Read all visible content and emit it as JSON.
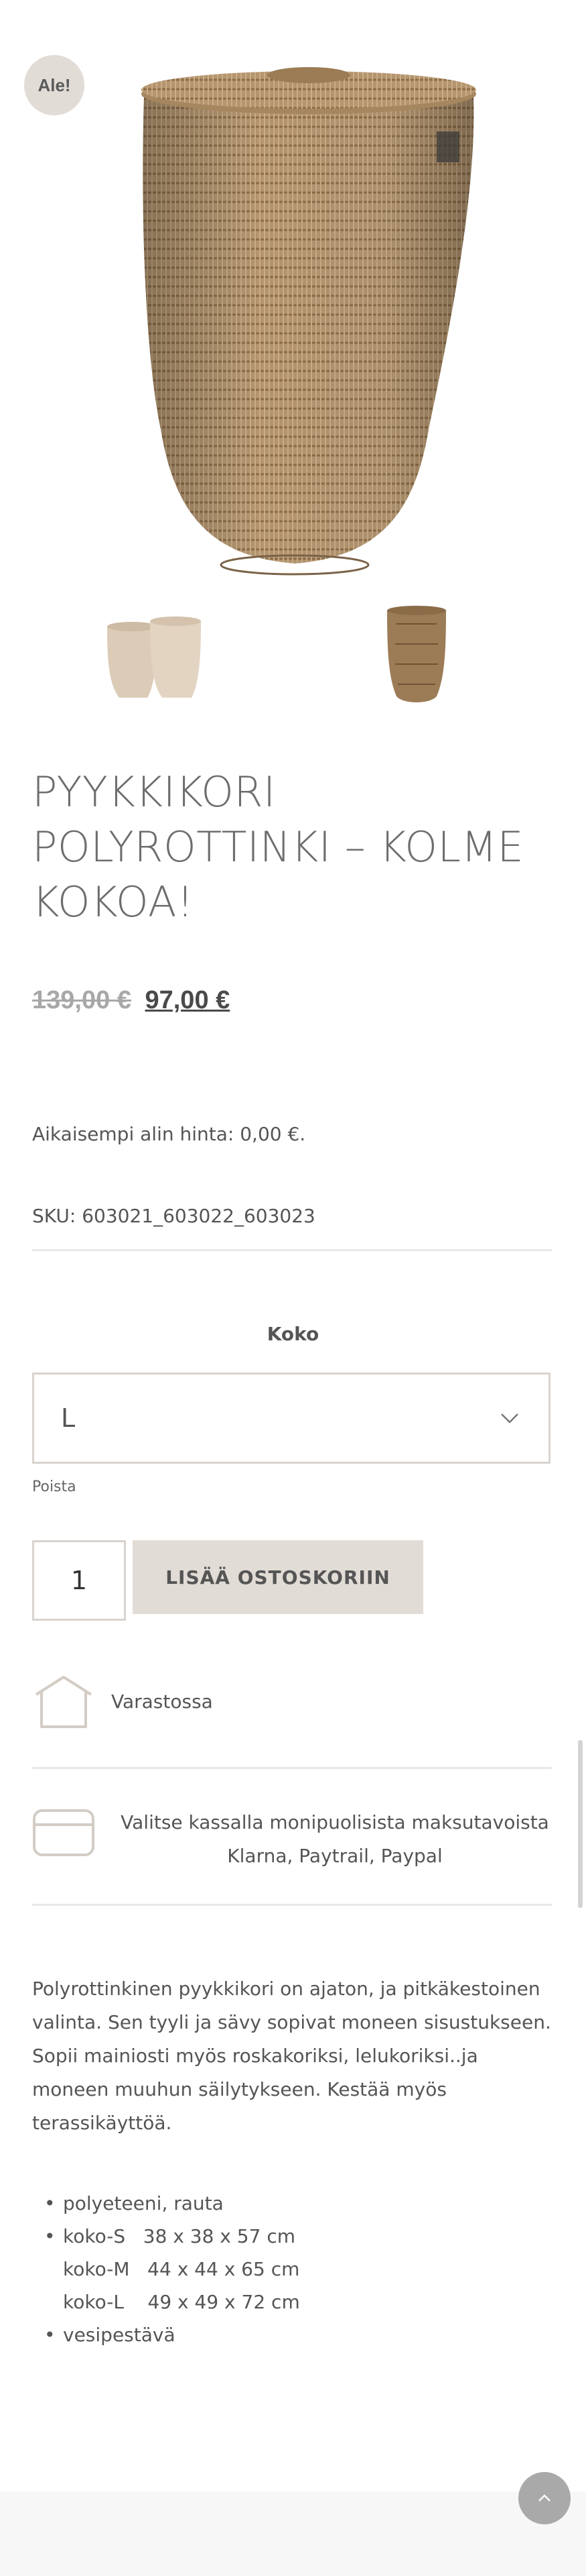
{
  "badge": {
    "label": "Ale!"
  },
  "product": {
    "title": "PYYKKIKORI POLYROTTINKI – KOLME KOKOA!",
    "price_old": "139,00 €",
    "price_new": "97,00 €",
    "previous_low": "Aikaisempi alin hinta: 0,00 €.",
    "sku": "SKU: 603021_603022_603023"
  },
  "variation": {
    "label": "Koko",
    "selected": "L",
    "reset_label": "Poista"
  },
  "cart": {
    "quantity": "1",
    "add_label": "LISÄÄ OSTOSKORIIN"
  },
  "info": {
    "stock": "Varastossa",
    "payment_line1": "Valitse kassalla monipuolisista maksutavoista",
    "payment_line2": "Klarna, Paytrail, Paypal"
  },
  "description": {
    "text": "Polyrottinkinen pyykkikori on ajaton, ja pitkäkestoinen valinta. Sen tyyli ja sävy sopivat moneen sisustukseen.  Sopii mainiosti myös roskakoriksi, lelukoriksi..ja moneen muuhun säilytykseen. Kestää myös terassikäyttöä.",
    "specs": [
      {
        "bullet": "•",
        "line": "polyeteeni, rauta"
      },
      {
        "bullet": "•",
        "line": "koko-S   38 x 38 x 57 cm"
      },
      {
        "bullet": "",
        "line": "koko-M   44 x 44 x 65 cm"
      },
      {
        "bullet": "",
        "line": "koko-L    49 x 49 x 72 cm"
      },
      {
        "bullet": "•",
        "line": "vesipestävä"
      }
    ]
  },
  "colors": {
    "accent": "#e2dcd6",
    "basket": "#a88a62"
  }
}
